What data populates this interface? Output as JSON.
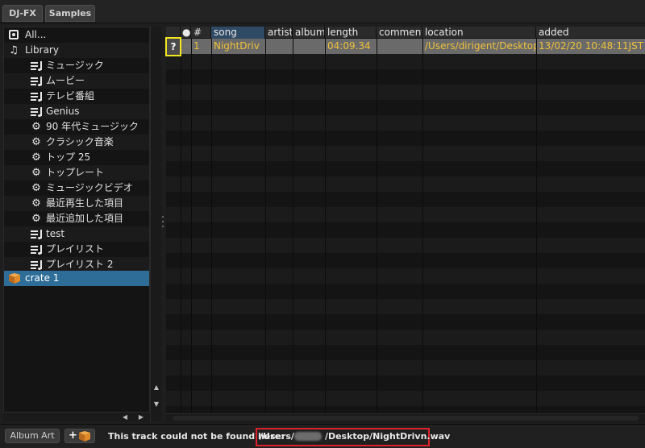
{
  "topbar": {
    "tabs": [
      "DJ-FX",
      "Samples"
    ]
  },
  "sidebar": {
    "items": [
      {
        "label": "All...",
        "icon": "all-icon"
      },
      {
        "label": "Library",
        "icon": "music-note-icon"
      },
      {
        "label": "ミュージック",
        "icon": "playlist-icon"
      },
      {
        "label": "ムービー",
        "icon": "playlist-icon"
      },
      {
        "label": "テレビ番組",
        "icon": "playlist-icon"
      },
      {
        "label": "Genius",
        "icon": "playlist-icon"
      },
      {
        "label": "90 年代ミュージック",
        "icon": "gear-icon"
      },
      {
        "label": "クラシック音楽",
        "icon": "gear-icon"
      },
      {
        "label": "トップ 25",
        "icon": "gear-icon"
      },
      {
        "label": "トップレート",
        "icon": "gear-icon"
      },
      {
        "label": "ミュージックビデオ",
        "icon": "gear-icon"
      },
      {
        "label": "最近再生した項目",
        "icon": "gear-icon"
      },
      {
        "label": "最近追加した項目",
        "icon": "gear-icon"
      },
      {
        "label": "test",
        "icon": "playlist-icon"
      },
      {
        "label": "プレイリスト",
        "icon": "playlist-icon"
      },
      {
        "label": "プレイリスト 2",
        "icon": "playlist-icon"
      },
      {
        "label": "crate 1",
        "icon": "crate-icon",
        "selected": true
      }
    ]
  },
  "table": {
    "columns": {
      "status": "●",
      "number": "#",
      "song": "song",
      "artist": "artist",
      "album": "album",
      "length": "length",
      "comment": "comment",
      "location": "location",
      "added": "added"
    },
    "rows": [
      {
        "missing_badge": "?",
        "number": "1",
        "song": "NightDriv",
        "artist": "",
        "album": "",
        "length": "04:09.34",
        "comment": "",
        "location": "/Users/dirigent/Desktop",
        "added": "13/02/20 10:48:11JST"
      }
    ]
  },
  "bottombar": {
    "album_art_label": "Album Art",
    "add_crate_label": "+",
    "status_message": "This track could not be found here:",
    "status_path_start": "/Users/",
    "status_path_end": "/Desktop/NightDrivn.wav"
  },
  "colors": {
    "track_text": "#f0c23a",
    "selected_crate": "#2d6d98",
    "badge_border": "#f3e71e",
    "path_highlight": "#e0222a",
    "crate_orange": "#e08a2a"
  }
}
